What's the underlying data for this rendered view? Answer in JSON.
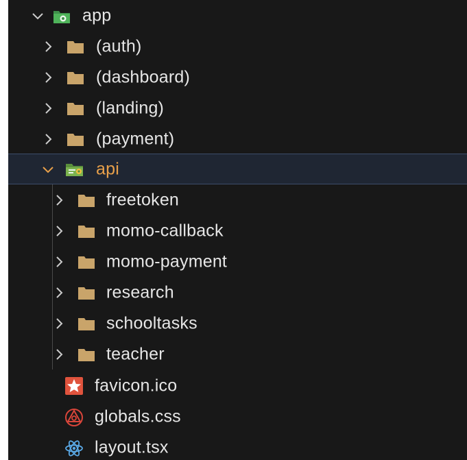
{
  "explorer": {
    "root": {
      "label": "app",
      "expanded": true,
      "icon": "app-folder-icon"
    },
    "app_children": [
      {
        "label": "(auth)",
        "expanded": false,
        "icon": "folder-icon"
      },
      {
        "label": "(dashboard)",
        "expanded": false,
        "icon": "folder-icon"
      },
      {
        "label": "(landing)",
        "expanded": false,
        "icon": "folder-icon"
      },
      {
        "label": "(payment)",
        "expanded": false,
        "icon": "folder-icon"
      }
    ],
    "api": {
      "label": "api",
      "expanded": true,
      "selected": true,
      "icon": "api-folder-icon"
    },
    "api_children": [
      {
        "label": "freetoken",
        "expanded": false,
        "icon": "folder-icon"
      },
      {
        "label": "momo-callback",
        "expanded": false,
        "icon": "folder-icon"
      },
      {
        "label": "momo-payment",
        "expanded": false,
        "icon": "folder-icon"
      },
      {
        "label": "research",
        "expanded": false,
        "icon": "folder-icon"
      },
      {
        "label": "schooltasks",
        "expanded": false,
        "icon": "folder-icon"
      },
      {
        "label": "teacher",
        "expanded": false,
        "icon": "folder-icon"
      }
    ],
    "files": [
      {
        "label": "favicon.ico",
        "icon": "star-file-icon"
      },
      {
        "label": "globals.css",
        "icon": "css-file-icon"
      },
      {
        "label": "layout.tsx",
        "icon": "react-file-icon"
      }
    ]
  },
  "colors": {
    "background": "#181818",
    "text": "#e6e6e6",
    "selected_text": "#e8a04a",
    "folder": "#c9a46a",
    "selected_row": "#1f2633",
    "chevron": "#cccccc"
  }
}
